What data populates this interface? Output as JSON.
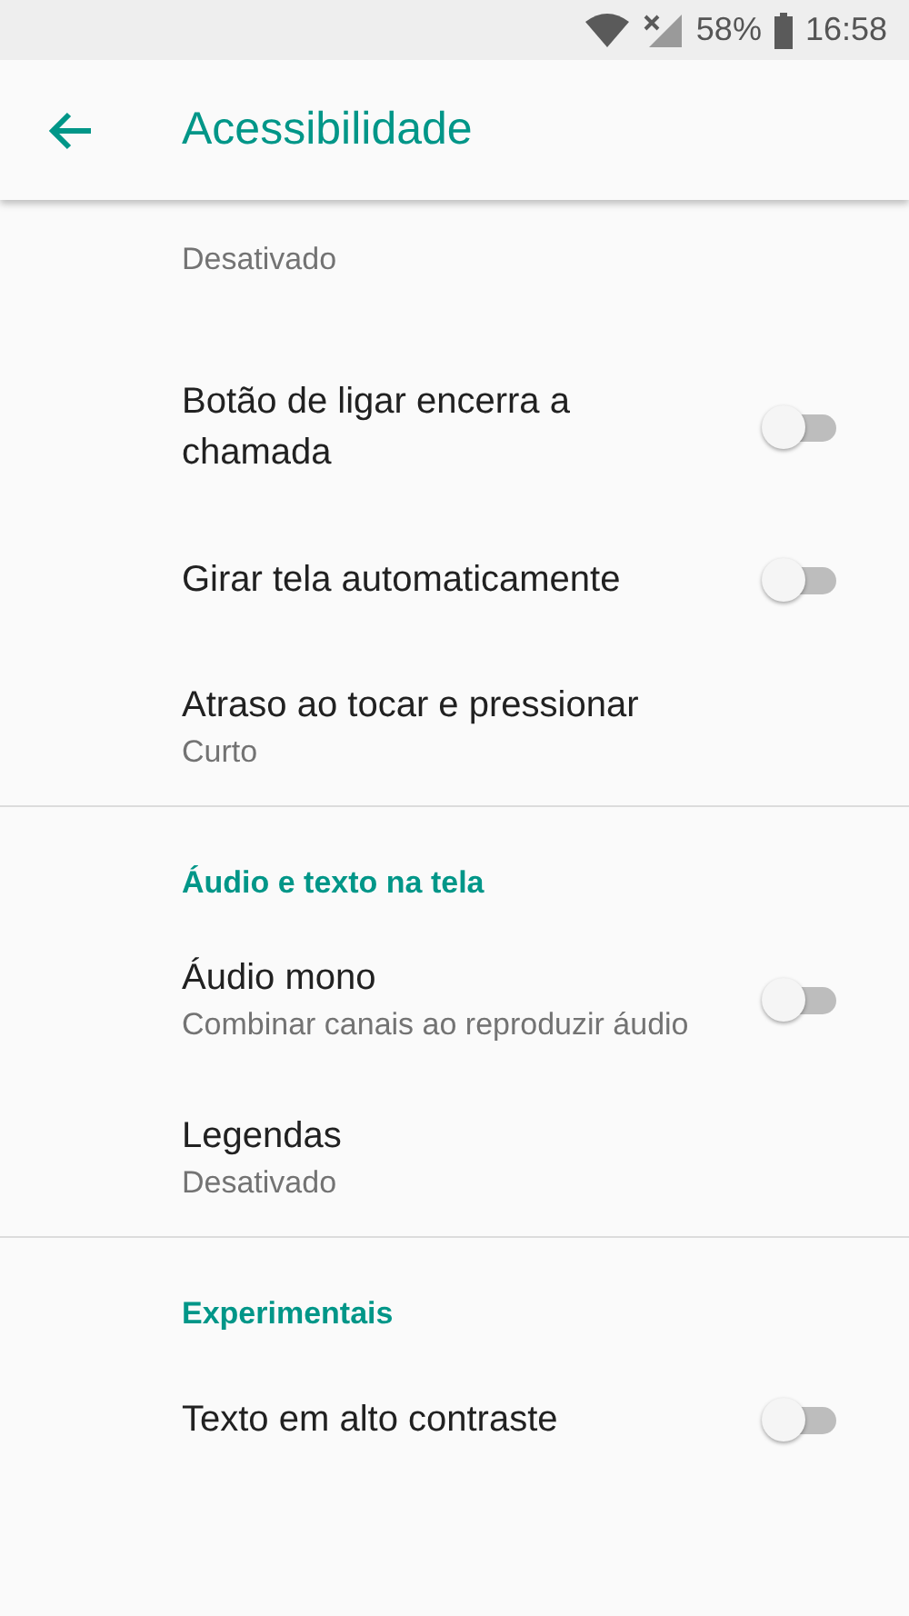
{
  "status_bar": {
    "battery": "58%",
    "time": "16:58"
  },
  "app_bar": {
    "title": "Acessibilidade"
  },
  "sections": [
    {
      "items": [
        {
          "kind": "text",
          "subtitle": "Desativado"
        },
        {
          "kind": "switch",
          "title": "Botão de ligar encerra a chamada",
          "on": false
        },
        {
          "kind": "switch",
          "title": "Girar tela automaticamente",
          "on": false
        },
        {
          "kind": "text",
          "title": "Atraso ao tocar e pressionar",
          "subtitle": "Curto"
        }
      ]
    },
    {
      "header": "Áudio e texto na tela",
      "items": [
        {
          "kind": "switch",
          "title": "Áudio mono",
          "subtitle": "Combinar canais ao reproduzir áudio",
          "on": false
        },
        {
          "kind": "text",
          "title": "Legendas",
          "subtitle": "Desativado"
        }
      ]
    },
    {
      "header": "Experimentais",
      "items": [
        {
          "kind": "switch",
          "title": "Texto em alto contraste",
          "on": false
        }
      ]
    }
  ]
}
